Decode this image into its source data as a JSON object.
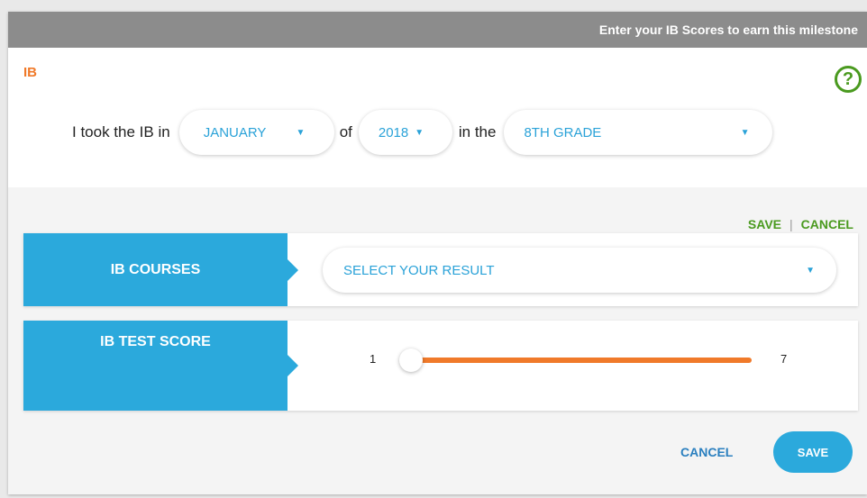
{
  "header": {
    "title": "Enter your IB Scores to earn this milestone"
  },
  "exam": {
    "label": "IB",
    "help_icon": "?"
  },
  "sentence": {
    "prefix": "I took the IB in",
    "month": "JANUARY",
    "of": "of",
    "year": "2018",
    "in_the": "in the",
    "grade": "8TH GRADE",
    "caret": "▼"
  },
  "actions": {
    "save": "SAVE",
    "separator": "|",
    "cancel": "CANCEL"
  },
  "courses": {
    "label": "IB COURSES",
    "select_placeholder": "SELECT YOUR RESULT"
  },
  "score": {
    "label": "IB TEST SCORE",
    "min": "1",
    "max": "7",
    "value": 1
  },
  "footer": {
    "cancel": "CANCEL",
    "save": "SAVE"
  },
  "colors": {
    "accent_blue": "#2ba9dc",
    "accent_orange": "#f07a2a",
    "accent_green": "#4a9a1f",
    "header_gray": "#8c8c8c"
  }
}
